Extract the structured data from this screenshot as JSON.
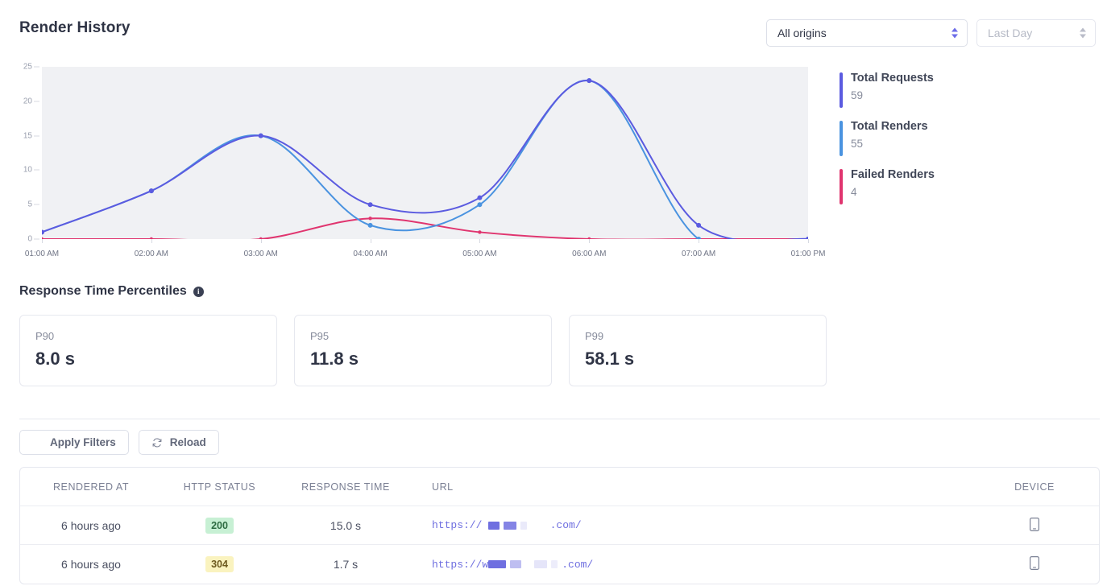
{
  "header": {
    "title": "Render History",
    "origin_select": {
      "value": "All origins",
      "icon": "chevron-updown-icon"
    },
    "range_select": {
      "value": "Last Day",
      "icon": "chevron-updown-icon"
    }
  },
  "stats": [
    {
      "label": "Total Requests",
      "value": "59",
      "color": "#5b5be0"
    },
    {
      "label": "Total Renders",
      "value": "55",
      "color": "#4a93e0"
    },
    {
      "label": "Failed Renders",
      "value": "4",
      "color": "#e0356f"
    }
  ],
  "percentiles": {
    "section_title": "Response Time Percentiles",
    "info_glyph": "i",
    "cards": [
      {
        "key": "P90",
        "value": "8.0 s"
      },
      {
        "key": "P95",
        "value": "11.8 s"
      },
      {
        "key": "P99",
        "value": "58.1 s"
      }
    ]
  },
  "toolbar": {
    "apply_filters_label": "Apply Filters",
    "reload_label": "Reload"
  },
  "table": {
    "columns": [
      "RENDERED AT",
      "HTTP STATUS",
      "RESPONSE TIME",
      "URL",
      "DEVICE"
    ],
    "rows": [
      {
        "rendered_at": "6 hours ago",
        "status": "200",
        "status_kind": "s200",
        "response_time": "15.0 s",
        "url_prefix": "https:// ",
        "url_suffix": "   .com/",
        "url_blocks": [
          {
            "w": 14,
            "o": 1
          },
          {
            "w": 16,
            "o": 0.85
          },
          {
            "w": 8,
            "o": 0.15
          }
        ],
        "device": "mobile-icon"
      },
      {
        "rendered_at": "6 hours ago",
        "status": "304",
        "status_kind": "s304",
        "response_time": "1.7 s",
        "url_prefix": "https://w",
        "url_suffix": ".com/",
        "url_blocks": [
          {
            "w": 22,
            "o": 1
          },
          {
            "w": 14,
            "o": 0.45
          },
          {
            "w": 6,
            "o": 0
          },
          {
            "w": 16,
            "o": 0.18
          },
          {
            "w": 8,
            "o": 0.12
          }
        ],
        "device": "mobile-icon"
      }
    ]
  },
  "chart_data": {
    "type": "line",
    "title": "Render History",
    "xlabel": "",
    "ylabel": "",
    "ylim": [
      0,
      25
    ],
    "yticks": [
      0,
      5,
      10,
      15,
      20,
      25
    ],
    "categories": [
      "01:00 AM",
      "02:00 AM",
      "03:00 AM",
      "04:00 AM",
      "05:00 AM",
      "06:00 AM",
      "07:00 AM",
      "01:00 PM"
    ],
    "grid": false,
    "legend_position": "right",
    "series": [
      {
        "name": "Total Requests",
        "color": "#5b5be0",
        "values": [
          1,
          7,
          15,
          5,
          6,
          23,
          2,
          0
        ]
      },
      {
        "name": "Total Renders",
        "color": "#4a93e0",
        "values": [
          1,
          7,
          15,
          2,
          5,
          23,
          0,
          0
        ]
      },
      {
        "name": "Failed Renders",
        "color": "#e0356f",
        "values": [
          0,
          0,
          0,
          3,
          1,
          0,
          0,
          0
        ]
      }
    ]
  }
}
